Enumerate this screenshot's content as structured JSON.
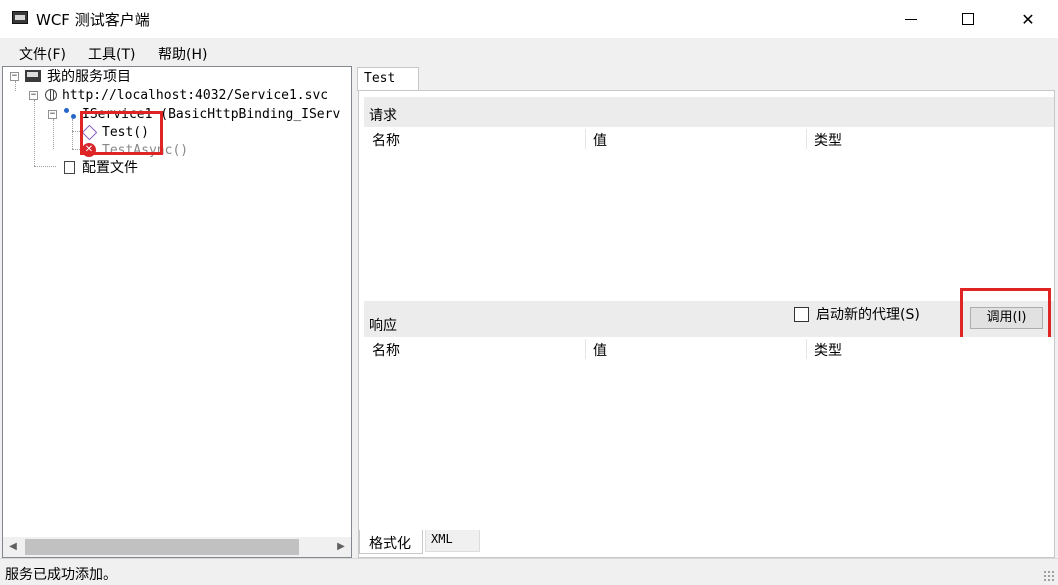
{
  "window": {
    "title": "WCF 测试客户端",
    "app_icon": "console-icon",
    "controls": {
      "minimize": "minimize-icon",
      "maximize": "maximize-icon",
      "close": "✕"
    }
  },
  "menu": [
    "文件(F)",
    "工具(T)",
    "帮助(H)"
  ],
  "tree": {
    "root": "我的服务项目",
    "service_url": "http://localhost:4032/Service1.svc",
    "contract": "IService1 (BasicHttpBinding_IServ",
    "operations": [
      "Test()",
      "TestAsync()"
    ],
    "config_file": "配置文件",
    "expander_symbol": "−"
  },
  "scrollbar": {
    "left_arrow": "◀",
    "right_arrow": "▶"
  },
  "tab": {
    "label": "Test"
  },
  "request": {
    "label": "请求",
    "columns": [
      "名称",
      "值",
      "类型"
    ]
  },
  "response": {
    "label": "响应",
    "columns": [
      "名称",
      "值",
      "类型"
    ]
  },
  "controls": {
    "new_proxy_label": "启动新的代理(S)",
    "new_proxy_checked": false,
    "invoke_label": "调用(I)"
  },
  "bottom_tabs": [
    "格式化",
    "XML"
  ],
  "status": {
    "text": "服务已成功添加。"
  },
  "colors": {
    "highlight_box": "#e02323",
    "error_icon": "#d9262d",
    "operation_icon": "#8a5bc4"
  }
}
